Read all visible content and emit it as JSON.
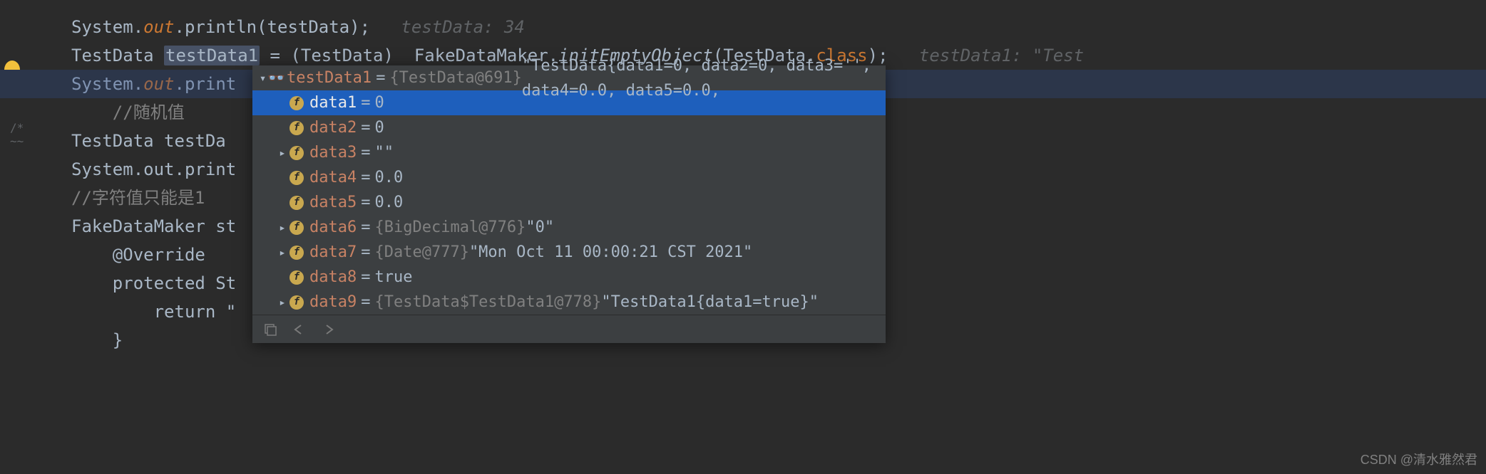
{
  "code": {
    "line1_a": "System.",
    "line1_b": "out",
    "line1_c": ".println(testData);",
    "line1_hint": "testData: 34",
    "line2_a": "TestData ",
    "line2_var": "testData1",
    "line2_b": " = (TestData)  FakeDataMaker.",
    "line2_method": "initEmptyObject",
    "line2_c": "(TestData.",
    "line2_class": "class",
    "line2_d": ");",
    "line2_hint": "testData1: \"Test",
    "line3_a": "System.",
    "line3_b": "out",
    "line3_c": ".print",
    "line4": "    //随机值",
    "line5": "TestData testDa",
    "line6": "System.out.print",
    "line7": "//字符值只能是1",
    "line8": "FakeDataMaker st",
    "line9": "    @Override",
    "line10": "    protected St",
    "line11": "        return \"",
    "line12": "    }"
  },
  "debug": {
    "root_name": "testData1",
    "root_eq": " = ",
    "root_type": "{TestData@691}",
    "root_val": " \"TestData{data1=0, data2=0, data3='', data4=0.0, data5=0.0, ",
    "rows": [
      {
        "name": "data1",
        "val": "0",
        "expandable": false,
        "selected": true,
        "indent": 44
      },
      {
        "name": "data2",
        "val": "0",
        "expandable": false,
        "selected": false,
        "indent": 44
      },
      {
        "name": "data3",
        "type": "",
        "val": "\"\"",
        "expandable": true,
        "selected": false,
        "indent": 24
      },
      {
        "name": "data4",
        "val": "0.0",
        "expandable": false,
        "selected": false,
        "indent": 44
      },
      {
        "name": "data5",
        "val": "0.0",
        "expandable": false,
        "selected": false,
        "indent": 44
      },
      {
        "name": "data6",
        "type": "{BigDecimal@776}",
        "val": " \"0\"",
        "expandable": true,
        "selected": false,
        "indent": 24
      },
      {
        "name": "data7",
        "type": "{Date@777}",
        "val": " \"Mon Oct 11 00:00:21 CST 2021\"",
        "expandable": true,
        "selected": false,
        "indent": 24
      },
      {
        "name": "data8",
        "val": "true",
        "expandable": false,
        "selected": false,
        "indent": 44
      },
      {
        "name": "data9",
        "type": "{TestData$TestData1@778}",
        "val": " \"TestData1{data1=true}\"",
        "expandable": true,
        "selected": false,
        "indent": 24
      }
    ]
  },
  "watermark": "CSDN @清水雅然君"
}
